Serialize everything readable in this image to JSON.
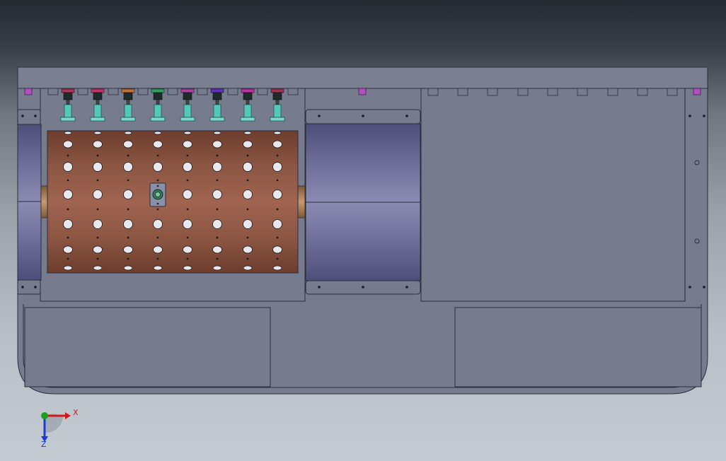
{
  "view": {
    "mode": "cad-model-viewport",
    "colors": {
      "background_top": "#252a31",
      "background_bottom": "#c5cbd3",
      "panel": "#767b8e",
      "panel_edge": "#2b2d3a",
      "roller": "#8a5440",
      "shaft": "#5f5f95",
      "nozzle_body": "#54c8b8",
      "axis_x": "#d01a1a",
      "axis_y": "#1aa01a",
      "axis_z": "#1a3cd0"
    }
  },
  "model": {
    "nozzles": [
      {
        "cap_color": "#b0305a"
      },
      {
        "cap_color": "#c8306a"
      },
      {
        "cap_color": "#c07030"
      },
      {
        "cap_color": "#30a060"
      },
      {
        "cap_color": "#b040a0"
      },
      {
        "cap_color": "#6030c0"
      },
      {
        "cap_color": "#c030a0"
      },
      {
        "cap_color": "#a03050"
      }
    ],
    "roller_hole_rows": 6,
    "roller_hole_columns": 8
  },
  "triad": {
    "x_label": "X",
    "z_label": "Z"
  }
}
